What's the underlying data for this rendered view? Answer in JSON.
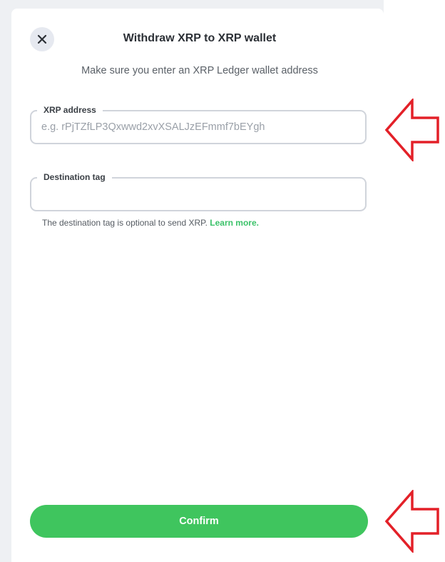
{
  "dialog": {
    "title": "Withdraw XRP to XRP wallet",
    "subtitle": "Make sure you enter an XRP Ledger wallet address",
    "close_icon": "close-icon"
  },
  "address_field": {
    "label": "XRP address",
    "placeholder": "e.g. rPjTZfLP3Qxwwd2xvXSALJzEFmmf7bEYgh",
    "value": ""
  },
  "destination_tag_field": {
    "label": "Destination tag",
    "placeholder": "",
    "value": "",
    "helper_text": "The destination tag is optional to send XRP.",
    "learn_more": "Learn more."
  },
  "confirm_label": "Confirm",
  "annotations": {
    "arrow_color": "#e32028",
    "arrow_icon": "left-arrow-outline-icon"
  },
  "colors": {
    "accent_green": "#3fc55e",
    "link_green": "#3cc26a"
  }
}
